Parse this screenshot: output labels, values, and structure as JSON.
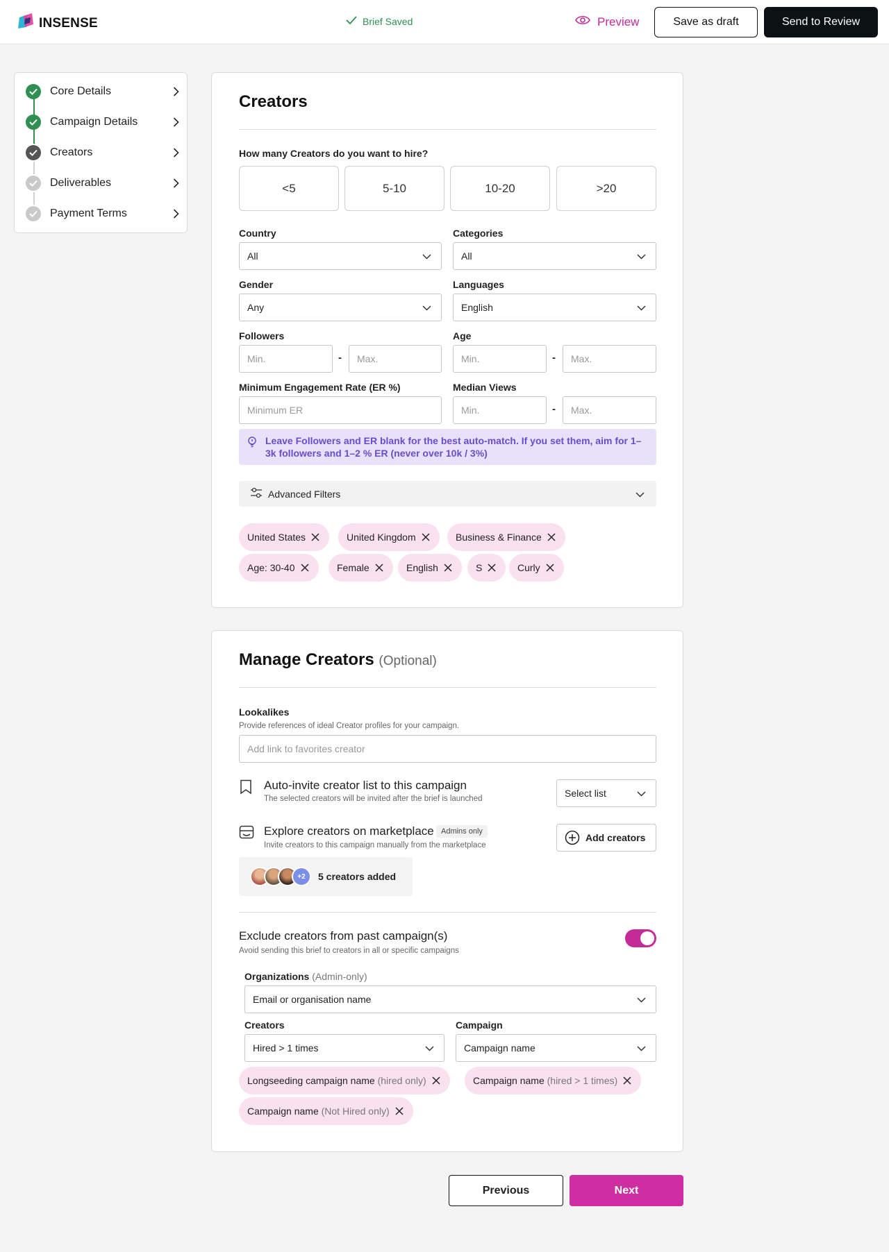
{
  "header": {
    "logo_text": "INSENSE",
    "saved_status": "Brief Saved",
    "preview_label": "Preview",
    "save_draft_label": "Save as draft",
    "send_review_label": "Send to Review"
  },
  "sidebar": {
    "steps": [
      {
        "label": "Core Details",
        "state": "done"
      },
      {
        "label": "Campaign Details",
        "state": "done"
      },
      {
        "label": "Creators",
        "state": "current"
      },
      {
        "label": "Deliverables",
        "state": "todo"
      },
      {
        "label": "Payment Terms",
        "state": "todo"
      }
    ]
  },
  "creators_card": {
    "title": "Creators",
    "hire_question": "How many Creators do you want to hire?",
    "hire_options": [
      "<5",
      "5-10",
      "10-20",
      ">20"
    ],
    "country": {
      "label": "Country",
      "value": "All"
    },
    "categories": {
      "label": "Categories",
      "value": "All"
    },
    "gender": {
      "label": "Gender",
      "value": "Any"
    },
    "languages": {
      "label": "Languages",
      "value": "English"
    },
    "followers": {
      "label": "Followers",
      "min_placeholder": "Min.",
      "max_placeholder": "Max."
    },
    "age": {
      "label": "Age",
      "min_placeholder": "Min.",
      "max_placeholder": "Max."
    },
    "min_er": {
      "label": "Minimum Engagement Rate (ER %)",
      "placeholder": "Minimum ER"
    },
    "median_views": {
      "label": "Median Views",
      "min_placeholder": "Min.",
      "max_placeholder": "Max."
    },
    "range_separator": "-",
    "tip": "Leave Followers and ER blank for the best auto-match. If you set them, aim for 1–3k followers and 1–2 % ER (never over 10k / 3%)",
    "advanced_filters_label": "Advanced Filters",
    "filter_chips": [
      "United States",
      "United Kingdom",
      "Business & Finance",
      "Age: 30-40",
      "Female",
      "English",
      "S",
      "Curly"
    ]
  },
  "manage_card": {
    "title": "Manage Creators",
    "optional": "(Optional)",
    "lookalikes": {
      "label": "Lookalikes",
      "description": "Provide references of ideal Creator profiles for your campaign.",
      "placeholder": "Add link to favorites creator"
    },
    "auto_invite": {
      "title": "Auto-invite creator list to this campaign",
      "description": "The selected creators will be invited after the brief is launched",
      "select_label": "Select list"
    },
    "explore": {
      "title": "Explore creators on marketplace",
      "badge": "Admins only",
      "description": "Invite creators to this campaign manually from the marketplace",
      "button_label": "Add creators",
      "more_count": "+2",
      "added_text": "5 creators added"
    },
    "exclude": {
      "title": "Exclude creators from past campaign(s)",
      "description": "Avoid sending this brief to creators in all or specific campaigns",
      "toggle_on": true,
      "organizations_label": "Organizations",
      "organizations_note": "(Admin-only)",
      "organizations_value": "Email or organisation name",
      "creators_label": "Creators",
      "creators_value": "Hired > 1 times",
      "campaign_label": "Campaign",
      "campaign_value": "Campaign name",
      "chips": [
        {
          "name": "Longseeding campaign name",
          "note": "(hired only)"
        },
        {
          "name": "Campaign name",
          "note": "(hired > 1 times)"
        },
        {
          "name": "Campaign name",
          "note": "(Not Hired only)"
        }
      ]
    }
  },
  "footer": {
    "previous_label": "Previous",
    "next_label": "Next"
  },
  "colors": {
    "brand_pink": "#cd2fa2",
    "success_green": "#2e8f50",
    "tip_purple": "#6b4bcc",
    "chip_pink": "#fae1f0"
  }
}
